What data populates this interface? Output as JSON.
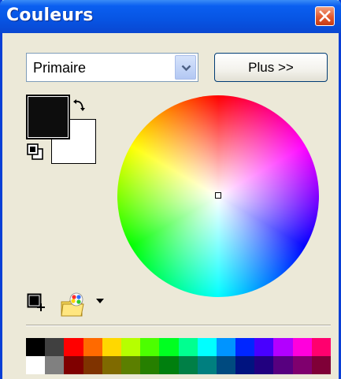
{
  "window": {
    "title": "Couleurs"
  },
  "dropdown": {
    "value": "Primaire"
  },
  "more_button": {
    "label": "Plus >>"
  },
  "swatches": {
    "primary_color": "#0d0d0d",
    "secondary_color": "#ffffff"
  },
  "icons": {
    "close": "close-icon",
    "swap": "swap-colors-icon",
    "reset": "reset-colors-icon",
    "add_swatch": "add-color-icon",
    "palette": "palette-icon",
    "menu_arrow": "chevron-down-icon"
  },
  "palette": {
    "row1": [
      "#000000",
      "#404040",
      "#ff0000",
      "#ff6a00",
      "#ffd800",
      "#b6ff00",
      "#4cff00",
      "#00ff21",
      "#00ff90",
      "#00ffff",
      "#0094ff",
      "#0026ff",
      "#4800ff",
      "#b200ff",
      "#ff00dc",
      "#ff006e"
    ],
    "row2": [
      "#ffffff",
      "#808080",
      "#7f0000",
      "#7f3300",
      "#7f6a00",
      "#5b7f00",
      "#267f00",
      "#007f0e",
      "#007f46",
      "#007f7f",
      "#004a7f",
      "#00137f",
      "#21007f",
      "#57007f",
      "#7f006e",
      "#7f0037"
    ]
  }
}
